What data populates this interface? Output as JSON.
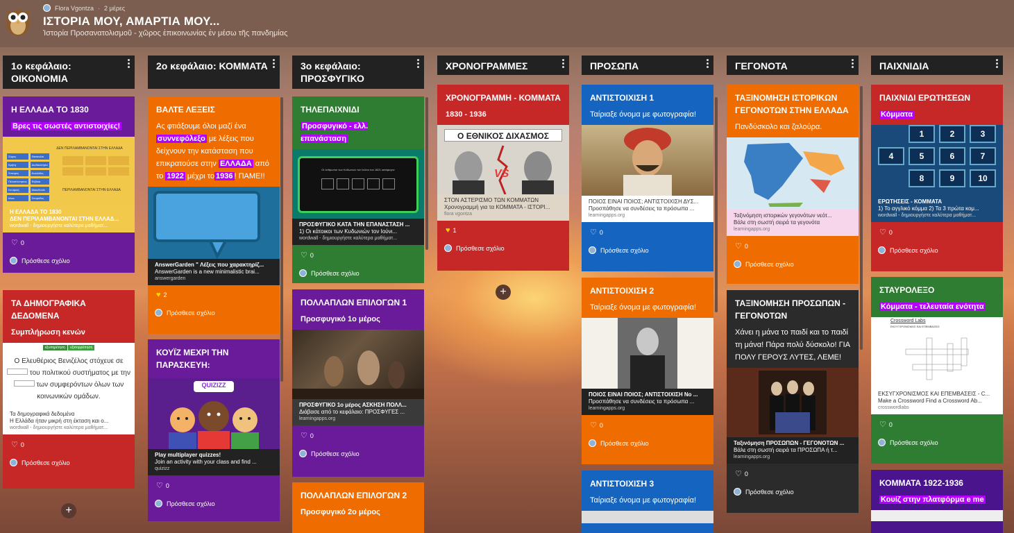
{
  "header": {
    "author": "Flora Vgontza",
    "time": "2 μέρες",
    "title": "ΙΣΤΟΡΙΑ ΜΟΥ, ΑΜΑΡΤΙΑ ΜΟΥ...",
    "subtitle": "Ἱστορία Προσανατολισμοῦ - χῶρος ἐπικοινωνίας ἐν μέσω τῆς πανδημίας"
  },
  "comment": "Πρόσθεσε σχόλιο",
  "columns": [
    {
      "title": "1ο κεφάλαιο: ΟΙΚΟΝΟΜΙΑ"
    },
    {
      "title": "2ο κεφάλαιο: ΚΟΜΜΑΤΑ"
    },
    {
      "title": "3ο κεφάλαιο: ΠΡΟΣΦΥΓΙΚΟ"
    },
    {
      "title": "ΧΡΟΝΟΓΡΑΜΜΕΣ"
    },
    {
      "title": "ΠΡΟΣΩΠΑ"
    },
    {
      "title": "ΓΕΓΟΝΟΤΑ"
    },
    {
      "title": "ΠΑΙΧΝΙΔΙΑ"
    }
  ],
  "c1": {
    "card1": {
      "title": "Η ΕΛΛΑΔΑ ΤΟ 1830",
      "body": "Βρες τις σωστές αντιστοιχίες!",
      "lt": "Η ΕΛΛΑΔΑ ΤΟ 1830",
      "ld": "ΔΕΝ ΠΕΡΙΛΑΜΒΑΝΟΝΤΑΙ ΣΤΗΝ ΕΛΛΑΔ...",
      "ls": "wordwall - δημιουργήστε καλύτερα μαθήματ...",
      "likes": "0",
      "imgtitle": "ΔΕΝ ΠΕΡΙΛΑΜΒΑΝΟΝΤΑΙ ΣΤΗΝ ΕΛΛΑΔΑ",
      "imgtitle2": "ΠΕΡΙΛΑΜΒΑΝΟΝΤΑΙ ΣΤΗΝ ΕΛΛΑΔΑ",
      "chips": [
        "Σάμος",
        "Θεσσαλία",
        "Κρήτη",
        "Δωδεκάνησα",
        "Ήπειρος",
        "Κυκλάδες",
        "Πελοπόννησος",
        "Εύβοια",
        "Κεντρική",
        "Μακεδονία",
        "Ιόνια",
        "Σποράδες"
      ]
    },
    "card2": {
      "title": "ΤΑ ΔΗΜΟΓΡΑΦΙΚΑ ΔΕΔΟΜΕΝΑ",
      "body": "Συμπλήρωση κενών",
      "chip1": "εξυπηρέτηση",
      "chip2": "εξισορρόπηση",
      "p1": "Ο Ελευθέριος Βενιζέλος στόχευε σε",
      "p2": "του πολιτικού συστήματος",
      "p3": "με την",
      "p4": "των συμφερόντων",
      "p5": "όλων των κοινωνικών ομάδων.",
      "lt": "Τα δημογραφικά δεδομένα",
      "ld": "Η Ελλάδα ήταν μικρή στη έκταση και ο...",
      "ls": "wordwall - δημιουργήστε καλύτερα μαθήματ...",
      "likes": "0"
    }
  },
  "c2": {
    "card1": {
      "title": "ΒΑΛΤΕ ΛΕΞΕΙΣ",
      "b1": "Ας φτιάξουμε όλοι μαζί ένα",
      "b2": "συννεφόλεξο",
      "b3": "με λέξεις που δείχνουν την κατάσταση που επικρατούσε στην",
      "b4": "ΕΛΛΑΔΑ",
      "b5": "από το",
      "b6": "1922",
      "b7": "μέχρι το",
      "b8": "1936",
      "b9": "! ΠΑΜΕ!!",
      "lt": "AnswerGarden \" Λέξεις που χαρακτηρίζ...",
      "ld": "AnswerGarden is a new minimalistic brai...",
      "ls": "answergarden",
      "likes": "2"
    },
    "card2": {
      "title": "ΚΟΥΪΖ ΜΕΧΡΙ ΤΗΝ ΠΑΡΑΣΚΕΥΗ:",
      "logo": "QUIZIZZ",
      "lt": "Play multiplayer quizzes!",
      "ld": "Join an activity with your class and find ...",
      "ls": "quizizz",
      "likes": "0"
    }
  },
  "c3": {
    "card1": {
      "title": "ΤΗΛΕΠΑΙΧΝΙΔΙ",
      "body": "Προσφυγικό - ελλ. επανάσταση",
      "imgtext": "Οι άνθρωποι των Κυδωνιών τον Ιούνιο του 1821 κατέφυγαν",
      "lt": "ΠΡΟΣΦΥΓΙΚΟ ΚΑΤΑ ΤΗΝ ΕΠΑΝΑΣΤΑΣΗ ...",
      "ld": "1) Οι κάτοικοι των Κυδωνιών τον Ιούνι...",
      "ls": "wordwall - δημιουργήστε καλύτερα μαθήματ...",
      "likes": "0"
    },
    "card2": {
      "title": "ΠΟΛΛΑΠΛΩΝ ΕΠΙΛΟΓΩΝ 1",
      "body": "Προσφυγικό 1ο μέρος",
      "lt": "ΠΡΟΣΦΥΓΙΚΟ 1ο μέρος ΑΣΚΗΣΗ ΠΟΛΛ...",
      "ld": "Διάβασε από το κεφάλαιο: ΠΡΟΣΦΥΓΕΣ ...",
      "ls": "learningapps.org",
      "likes": "0"
    },
    "card3": {
      "title": "ΠΟΛΛΑΠΛΩΝ ΕΠΙΛΟΓΩΝ 2",
      "body": "Προσφυγικό 2ο μέρος"
    }
  },
  "c4": {
    "card1": {
      "title": "ΧΡΟΝΟΓΡΑΜΜΗ - ΚΟΜΜΑΤΑ",
      "body": "1830 - 1936",
      "imgtitle": "Ο ΕΘΝΙΚΟΣ ΔΙΧΑΣΜΟΣ",
      "vs": "VS",
      "lt": "ΣΤΟΝ ΑΣΤΕΡΙΣΜΟ ΤΩΝ ΚΟΜΜΑΤΩΝ",
      "ld": "Χρονογραμμή για τα ΚΟΜΜΑΤΑ - ΙΣΤΟΡΙ...",
      "ls": "flora vgontza",
      "likes": "1"
    }
  },
  "c5": {
    "card1": {
      "title": "ΑΝΤΙΣΤΟΙΧΙΣΗ 1",
      "body": "Ταίριαξε όνομα με φωτογραφία!",
      "lt": "ΠΟΙΟΣ ΕΙΝΑΙ ΠΟΙΟΣ; ΑΝΤΙΣΤΟΙΧΙΣΗ ΔΥΣ...",
      "ld": "Προσπάθησε να συνδέσεις τα πρόσωπα ...",
      "ls": "learningapps.org",
      "likes": "0"
    },
    "card2": {
      "title": "ΑΝΤΙΣΤΟΙΧΙΣΗ 2",
      "body": "Ταίριαξε όνομα με φωτογραφία!",
      "lt": "ΠΟΙΟΣ ΕΙΝΑΙ ΠΟΙΟΣ; ΑΝΤΙΣΤΟΙΧΙΣΗ Νο ...",
      "ld": "Προσπάθησε να συνδέσεις τα πρόσωπα ...",
      "ls": "learningapps.org",
      "likes": "0"
    },
    "card3": {
      "title": "ΑΝΤΙΣΤΟΙΧΙΣΗ 3",
      "body": "Ταίριαξε όνομα με φωτογραφία!"
    }
  },
  "c6": {
    "card1": {
      "title": "ΤΑΞΙΝΟΜΗΣΗ ΙΣΤΟΡΙΚΩΝ ΓΕΓΟΝΟΤΩΝ ΣΤΗΝ ΕΛΛΑΔΑ",
      "body": "Πανδύσκολο και ζαλούρα.",
      "lt": "Ταξινόμηση ιστορικών γεγονότων νεότ...",
      "ld": "Βάλε στη σωστή σειρά τα γεγονότα",
      "ls": "learningapps.org",
      "likes": "0"
    },
    "card2": {
      "title": "ΤΑΞΙΝΟΜΗΣΗ ΠΡΟΣΩΠΩΝ - ΓΕΓΟΝΟΤΩΝ",
      "body": "Χάνει η μάνα το παιδί και το παιδί τη μάνα! Πάρα πολύ δύσκολο! ΓΙΑ ΠΟΛΥ ΓΕΡΟΥΣ ΛΥΤΕΣ, ΛΕΜΕ!",
      "lt": "Ταξινόμηση ΠΡΟΣΩΠΩΝ - ΓΕΓΟΝΟΤΩΝ ...",
      "ld": "Βάλε στη σωστή σειρά τα ΠΡΟΣΩΠΑ ή τ...",
      "ls": "learningapps.org",
      "likes": "0"
    }
  },
  "c7": {
    "card1": {
      "title": "ΠΑΙΧΝΙΔΙ ΕΡΩΤΗΣΕΩΝ",
      "body": "Κόμματα",
      "nums": [
        "1",
        "2",
        "3",
        "4",
        "5",
        "6",
        "7",
        "8",
        "9",
        "10"
      ],
      "lt": "ΕΡΩΤΗΣΕΙΣ - ΚΟΜΜΑΤΑ",
      "ld": "1) Το αγγλικό κόμμα 2) Τα 3 πρώτα κομ...",
      "ls": "wordwall - δημιουργήστε καλύτερα μαθήματ...",
      "likes": "0"
    },
    "card2": {
      "title": "ΣΤΑΥΡΟΛΕΞΟ",
      "body": "Κόμματα - τελευταία ενότητα",
      "imgtitle": "Crossword Labs",
      "imgsub": "ΕΚΣΥΓΧΡΟΝΙΣΜΟΣ ΚΑΙ ΕΠΕΜΒΑΣΕΙΣ",
      "lt": "ΕΚΣΥΓΧΡΟΝΙΣΜΟΣ ΚΑΙ ΕΠΕΜΒΑΣΕΙΣ - C...",
      "ld": "Make a Crossword Find a Crossword Ab...",
      "ls": "crosswordlabs",
      "likes": "0"
    },
    "card3": {
      "title": "ΚΟΜΜΑΤΑ 1922-1936",
      "body": "Κουίζ στην πλατφόρμα e me"
    }
  },
  "colors": {
    "red": "#c62828",
    "purple": "#6a1b9a",
    "orange": "#ef6c00",
    "green": "#2e7d32",
    "blue": "#1565c0",
    "dark": "#2b2b2b"
  }
}
